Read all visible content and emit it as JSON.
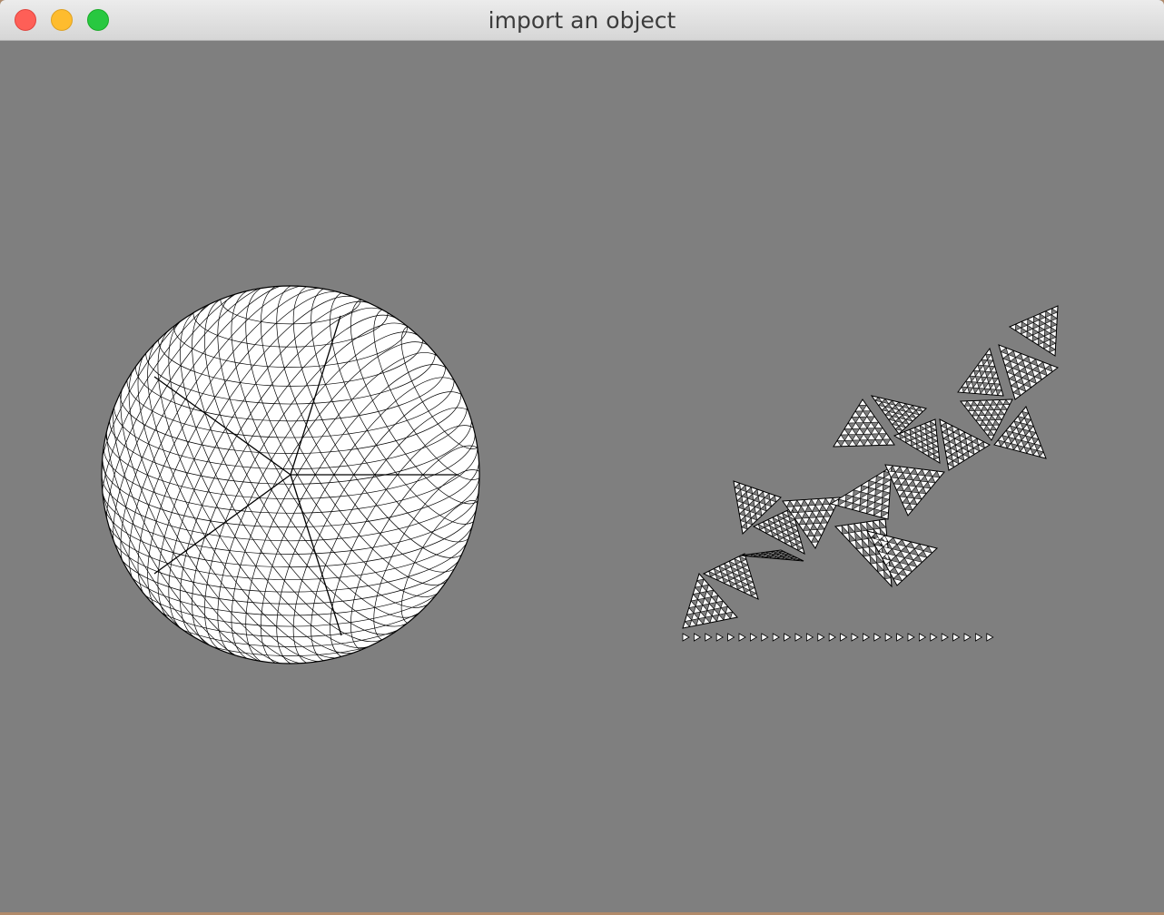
{
  "window": {
    "title": "import an object",
    "controls": {
      "close": "close-button",
      "minimize": "minimize-button",
      "zoom": "zoom-button"
    }
  },
  "viewport": {
    "background": "#7f7f7f",
    "mesh_fill": "#ffffff",
    "mesh_stroke": "#000000",
    "objects": [
      "geodesic-sphere-mesh",
      "unfolded-mesh-net"
    ]
  }
}
